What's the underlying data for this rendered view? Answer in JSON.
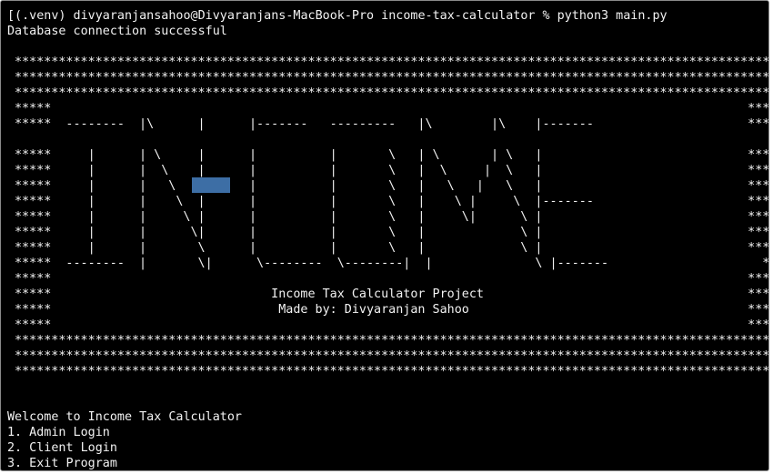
{
  "terminal": {
    "prompt_line": "[(.venv) divyaranjansahoo@Divyaranjans-MacBook-Pro income-tax-calculator % python3 main.py",
    "status": "Database connection successful",
    "banner": [
      "*********************************************************************************************************",
      "*********************************************************************************************************",
      "*********************************************************************************************************",
      "*****                                                                                               *****",
      "*****  --------  |\\      |      |-------   ---------   |\\        |\\    |-------                     *****",
      "",
      "*****     |      | \\     |      |          |       \\   | \\       | \\   |                            *****",
      "*****     |      |  \\    |      |          |       \\   |  \\     |  \\   |                            *****",
      "*****     |      |   \\   |      |          |       \\   |   \\   |   \\   |                            *****",
      "*****     |      |    \\  |      |          |       \\   |    \\ |     \\  |-------                     *****",
      "*****     |      |     \\ |      |          |       \\   |     \\|      \\ |                            *****",
      "*****     |      |      \\|      |          |       \\   |             \\ |                            *****",
      "*****     |      |       \\      |          |       \\   |             \\ |                            *****",
      "*****  --------  |       \\|      \\--------  \\--------|  |              \\ |-------                     *****",
      "*****                                                                                               *****",
      "*****                              Income Tax Calculator Project                                    *****",
      "*****                               Made by: Divyaranjan Sahoo                                      *****",
      "*****                                                                                               *****",
      "*********************************************************************************************************",
      "*********************************************************************************************************",
      "*********************************************************************************************************"
    ],
    "menu": {
      "welcome": "Welcome to Income Tax Calculator",
      "option1": "1. Admin Login",
      "option2": "2. Client Login",
      "option3": "3. Exit Program"
    }
  },
  "colors": {
    "background": "#000000",
    "text": "#f2f2f2",
    "cursor": "#3d6ea5"
  }
}
